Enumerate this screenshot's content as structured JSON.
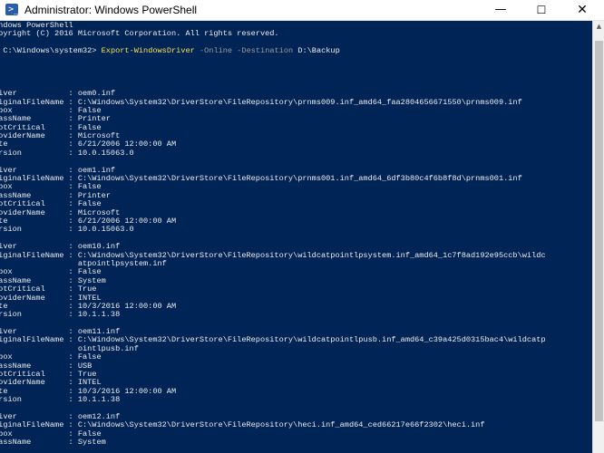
{
  "window": {
    "title": "Administrator: Windows PowerShell",
    "accent": "#012456"
  },
  "controls": {
    "minimize": "—",
    "maximize": "☐",
    "close": "✕"
  },
  "prompt": {
    "text": "S C:\\Windows\\system32>",
    "command": "Export-WindowsDriver",
    "param1": "-Online",
    "param2": "-Destination",
    "value": "D:\\Backup"
  },
  "lines": {
    "l0": "indows PowerShell",
    "l1": "opyright (C) 2016 Microsoft Corporation. All rights reserved.",
    "l3": ">",
    "l4": ">",
    "l6": "river           : oem0.inf",
    "l7": "riginalFileName : C:\\Windows\\System32\\DriverStore\\FileRepository\\prnms009.inf_amd64_faa2804656671550\\prnms009.inf",
    "l8": "nbox            : False",
    "l9": "lassName        : Printer",
    "l10": "ootCritical     : False",
    "l11": "roviderName     : Microsoft",
    "l12": "ate             : 6/21/2006 12:00:00 AM",
    "l13": "ersion          : 10.0.15063.0",
    "l15": "river           : oem1.inf",
    "l16": "riginalFileName : C:\\Windows\\System32\\DriverStore\\FileRepository\\prnms001.inf_amd64_6df3b80c4f6b8f8d\\prnms001.inf",
    "l17": "nbox            : False",
    "l18": "lassName        : Printer",
    "l19": "ootCritical     : False",
    "l20": "roviderName     : Microsoft",
    "l21": "ate             : 6/21/2006 12:00:00 AM",
    "l22": "ersion          : 10.0.15063.0",
    "l24": "river           : oem10.inf",
    "l25": "riginalFileName : C:\\Windows\\System32\\DriverStore\\FileRepository\\wildcatpointlpsystem.inf_amd64_1c7f8ad192e95ccb\\wildc",
    "l26": "                  atpointlpsystem.inf",
    "l27": "nbox            : False",
    "l28": "lassName        : System",
    "l29": "ootCritical     : True",
    "l30": "roviderName     : INTEL",
    "l31": "ate             : 10/3/2016 12:00:00 AM",
    "l32": "ersion          : 10.1.1.38",
    "l34": "river           : oem11.inf",
    "l35": "riginalFileName : C:\\Windows\\System32\\DriverStore\\FileRepository\\wildcatpointlpusb.inf_amd64_c39a425d0315bac4\\wildcatp",
    "l36": "                  ointlpusb.inf",
    "l37": "nbox            : False",
    "l38": "lassName        : USB",
    "l39": "ootCritical     : True",
    "l40": "roviderName     : INTEL",
    "l41": "ate             : 10/3/2016 12:00:00 AM",
    "l42": "ersion          : 10.1.1.38",
    "l44": "river           : oem12.inf",
    "l45": "riginalFileName : C:\\Windows\\System32\\DriverStore\\FileRepository\\heci.inf_amd64_ced66217e66f2302\\heci.inf",
    "l46": "nbox            : False",
    "l47": "lassName        : System"
  }
}
